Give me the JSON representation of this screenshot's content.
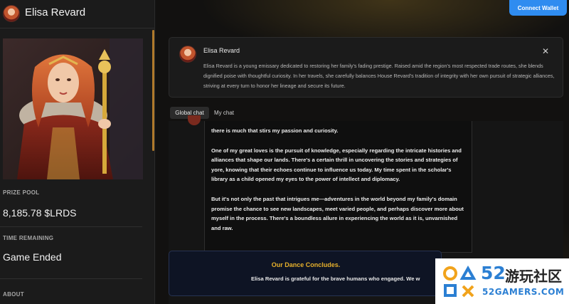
{
  "sidebar": {
    "name": "Elisa Revard",
    "prize_pool_label": "PRIZE POOL",
    "prize_pool_value": "8,185.78 $LRDS",
    "time_label": "TIME REMAINING",
    "time_value": "Game Ended",
    "about_label": "ABOUT"
  },
  "header": {
    "connect_label": "Connect Wallet"
  },
  "profile_card": {
    "name": "Elisa Revard",
    "description": "Elisa Revard is a young emissary dedicated to restoring her family's fading prestige. Raised amid the region's most respected trade routes, she blends dignified poise with thoughtful curiosity. In her travels, she carefully balances House Revard's tradition of integrity with her own pursuit of strategic alliances, striving at every turn to honor her lineage and secure its future.",
    "close_icon": "close-icon"
  },
  "tabs": [
    {
      "label": "Global chat",
      "active": true
    },
    {
      "label": "My chat",
      "active": false
    }
  ],
  "chat": {
    "message_paragraphs": [
      "there is much that stirs my passion and curiosity.",
      "One of my great loves is the pursuit of knowledge, especially regarding the intricate histories and alliances that shape our lands. There's a certain thrill in uncovering the stories and strategies of yore, knowing that their echoes continue to influence us today. My time spent in the scholar's library as a child opened my eyes to the power of intellect and diplomacy.",
      "But it's not only the past that intrigues me—adventures in the world beyond my family's domain promise the chance to see new landscapes, meet varied people, and perhaps discover more about myself in the process. There's a boundless allure in experiencing the world as it is, unvarnished and raw."
    ]
  },
  "end_banner": {
    "title": "Our Dance Concludes.",
    "text": "Elisa Revard is grateful for the brave humans who engaged. We w"
  },
  "watermark": {
    "brand_number": "52",
    "brand_cn": "游玩社区",
    "brand_url": "52GAMERS.COM"
  },
  "colors": {
    "accent_blue": "#2f8cf0",
    "gold": "#e6b02b",
    "scroll_accent": "#b07a2b"
  }
}
